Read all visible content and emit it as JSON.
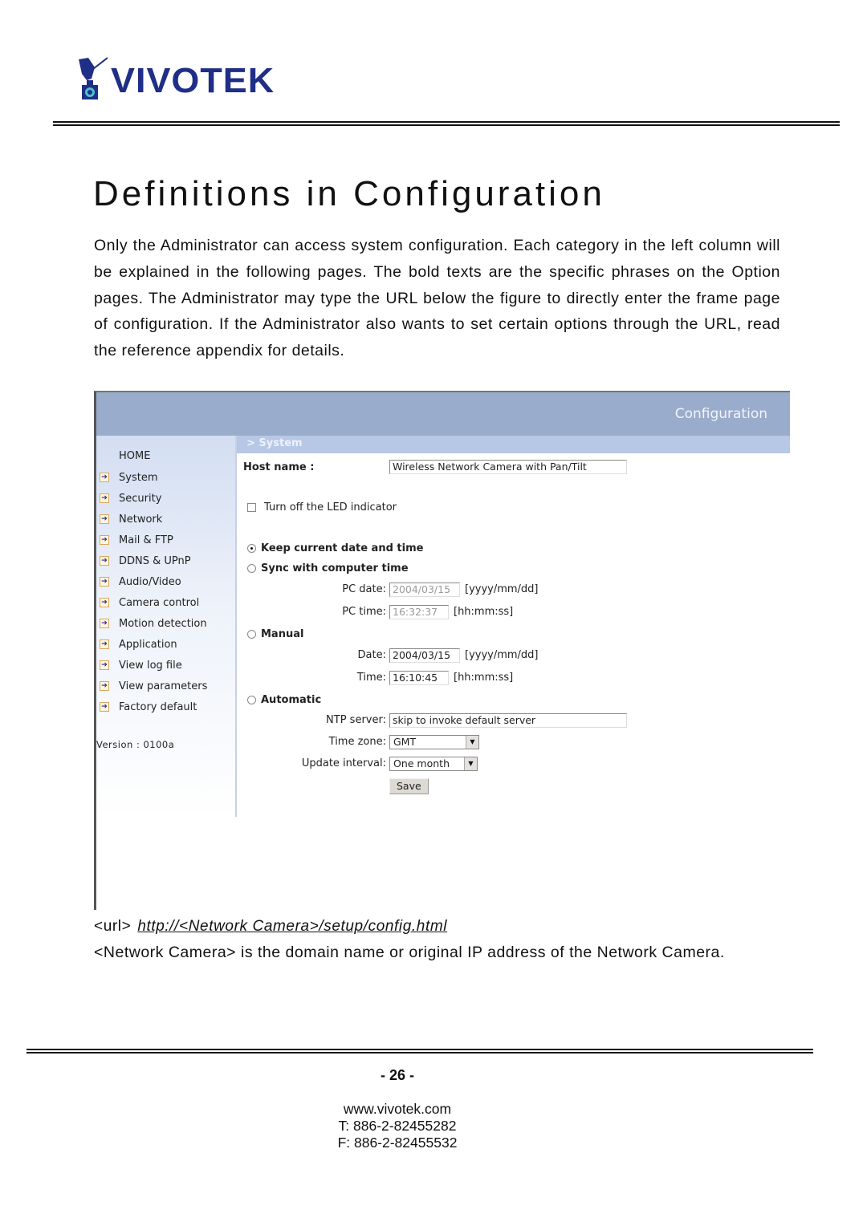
{
  "brand": {
    "logo_text": "VIVOTEK",
    "logo_color": "#1f2e86",
    "logo_accent": "#4ec0c8"
  },
  "document": {
    "title": "Definitions in Configuration",
    "intro": "Only the Administrator can access system configuration. Each category in the left column will be explained in the following pages. The bold texts are the specific phrases on the Option pages. The Administrator may type the URL below the figure to directly enter the frame page of configuration. If the Administrator also wants to set certain options through the URL, read the reference appendix for details.",
    "url_prefix": "<url>",
    "url": "http://<Network Camera>/setup/config.html",
    "note": "<Network Camera> is the domain name or original IP address of the Network Camera."
  },
  "figure": {
    "header_title": "Configuration",
    "header_color": "#9aaccc",
    "subheader": "> System",
    "sidebar": {
      "home": "HOME",
      "items": [
        {
          "label": "System"
        },
        {
          "label": "Security"
        },
        {
          "label": "Network"
        },
        {
          "label": "Mail & FTP"
        },
        {
          "label": "DDNS & UPnP"
        },
        {
          "label": "Audio/Video"
        },
        {
          "label": "Camera control"
        },
        {
          "label": "Motion detection"
        },
        {
          "label": "Application"
        },
        {
          "label": "View log file"
        },
        {
          "label": "View parameters"
        },
        {
          "label": "Factory default"
        }
      ],
      "version": "Version : 0100a"
    },
    "form": {
      "host_name_label": "Host name :",
      "host_name_value": "Wireless Network Camera with Pan/Tilt",
      "led_label": "Turn off the LED indicator",
      "led_checked": false,
      "keep_label": "Keep current date and time",
      "keep_selected": true,
      "sync_label": "Sync with computer time",
      "sync_selected": false,
      "pc_date_label": "PC date:",
      "pc_date_value": "2004/03/15",
      "pc_date_hint": "[yyyy/mm/dd]",
      "pc_time_label": "PC time:",
      "pc_time_value": "16:32:37",
      "pc_time_hint": "[hh:mm:ss]",
      "manual_label": "Manual",
      "manual_selected": false,
      "date_label": "Date:",
      "date_value": "2004/03/15",
      "date_hint": "[yyyy/mm/dd]",
      "time_label": "Time:",
      "time_value": "16:10:45",
      "time_hint": "[hh:mm:ss]",
      "automatic_label": "Automatic",
      "automatic_selected": false,
      "ntp_label": "NTP server:",
      "ntp_value": "skip to invoke default server",
      "timezone_label": "Time zone:",
      "timezone_value": "GMT",
      "interval_label": "Update interval:",
      "interval_value": "One month",
      "save_label": "Save"
    }
  },
  "footer": {
    "page_number": "- 26 -",
    "website": "www.vivotek.com",
    "phone": "T: 886-2-82455282",
    "fax": "F: 886-2-82455532"
  }
}
